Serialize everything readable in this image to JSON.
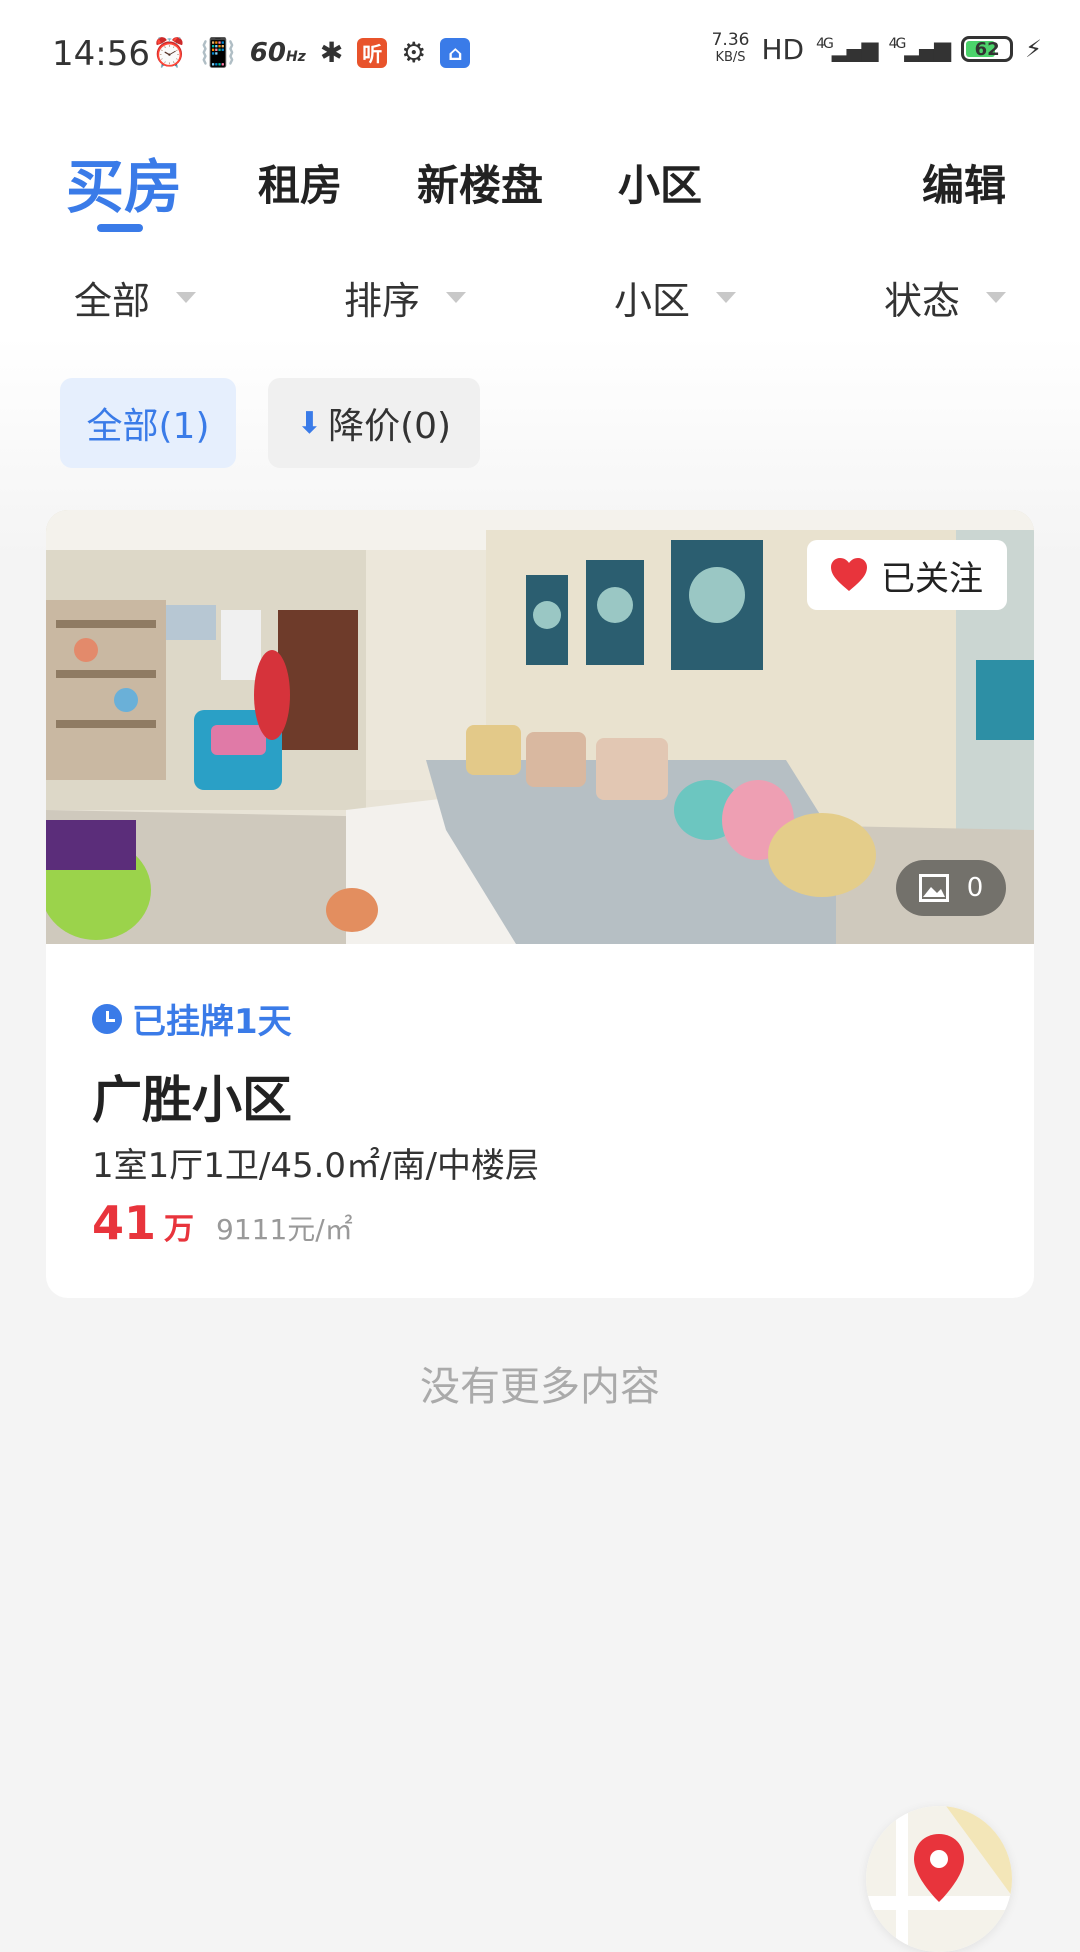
{
  "status_bar": {
    "time": "14:56",
    "refresh_rate": "60",
    "refresh_unit": "Hz",
    "listen_badge": "听",
    "net_speed": "7.36",
    "net_unit": "KB/S",
    "hd_label": "HD",
    "signal_1": "4G",
    "signal_2": "4G",
    "battery": "62"
  },
  "tabs": [
    {
      "label": "买房",
      "active": true
    },
    {
      "label": "租房",
      "active": false
    },
    {
      "label": "新楼盘",
      "active": false
    },
    {
      "label": "小区",
      "active": false
    }
  ],
  "edit_label": "编辑",
  "filters": [
    {
      "label": "全部"
    },
    {
      "label": "排序"
    },
    {
      "label": "小区"
    },
    {
      "label": "状态"
    }
  ],
  "chips": {
    "all": "全部(1)",
    "price_drop": "降价(0)"
  },
  "listing": {
    "followed_label": "已关注",
    "photo_count": "0",
    "listed_time": "已挂牌1天",
    "title": "广胜小区",
    "spec": "1室1厅1卫/45.0㎡/南/中楼层",
    "price": "41",
    "price_unit": "万",
    "unit_price": "9111元/㎡"
  },
  "footer_text": "没有更多内容",
  "colors": {
    "accent": "#3a7be8",
    "price": "#e8343c",
    "heart": "#e8343c"
  }
}
